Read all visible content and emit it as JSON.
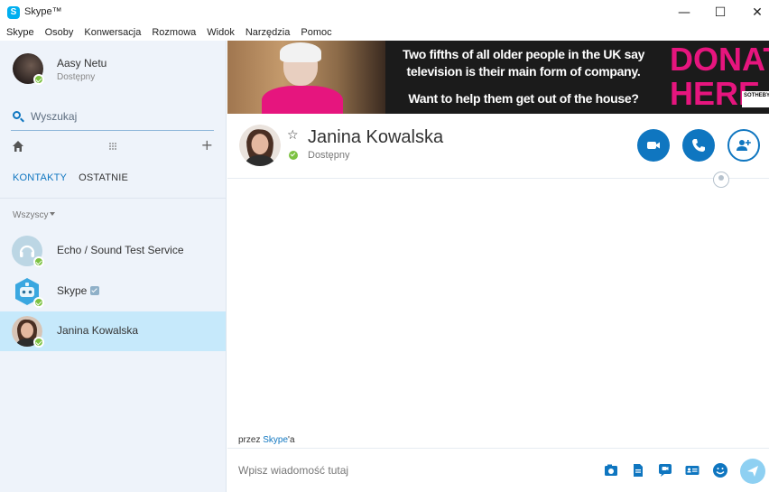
{
  "window": {
    "title": "Skype™",
    "minimize_glyph": "—",
    "maximize_glyph": "☐",
    "close_glyph": "✕"
  },
  "menu": [
    "Skype",
    "Osoby",
    "Konwersacja",
    "Rozmowa",
    "Widok",
    "Narzędzia",
    "Pomoc"
  ],
  "profile": {
    "name": "Aasy Netu",
    "status": "Dostępny"
  },
  "search": {
    "placeholder": "Wyszukaj"
  },
  "tabs": {
    "contacts": "KONTAKTY",
    "recent": "OSTATNIE"
  },
  "filter": {
    "label": "Wszyscy"
  },
  "contacts": [
    {
      "name": "Echo / Sound Test Service",
      "avatar": "headset-icon",
      "selected": false
    },
    {
      "name": "Skype",
      "avatar": "skype-bot-icon",
      "verified": true,
      "selected": false
    },
    {
      "name": "Janina Kowalska",
      "avatar": "photo",
      "selected": true
    }
  ],
  "banner": {
    "line1": "Two fifths of all older people in the UK say",
    "line2": "television is their main form of company.",
    "line3": "Want to help them get out of the house?",
    "donate": "DONATE",
    "here": "HERE",
    "logo_text": "SOTHEBY'S NEWS"
  },
  "conversation": {
    "name": "Janina Kowalska",
    "status": "Dostępny"
  },
  "byline": {
    "prefix": "przez ",
    "link": "Skype",
    "suffix": "'a"
  },
  "compose": {
    "placeholder": "Wpisz wiadomość tutaj"
  },
  "colors": {
    "accent": "#0f76c0",
    "presence": "#7dc242",
    "sidebar": "#eef3fa",
    "selected": "#c6e9fb",
    "banner_pink": "#e6157e"
  }
}
